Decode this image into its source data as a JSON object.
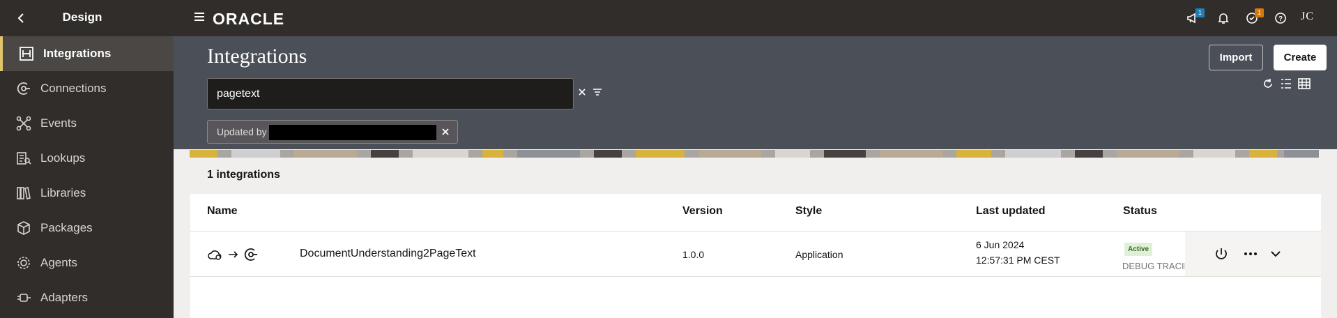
{
  "sidebar_header": {
    "title": "Design"
  },
  "topbar": {
    "brand": "ORACLE",
    "announcements_badge": "1",
    "tasks_badge": "1",
    "user_initials": "JC",
    "badge_colors": {
      "announcements": "#1f7fb5",
      "tasks": "#d97706"
    }
  },
  "sidebar": {
    "items": [
      {
        "label": "Integrations",
        "icon": "integrations-icon",
        "active": true
      },
      {
        "label": "Connections",
        "icon": "connections-icon"
      },
      {
        "label": "Events",
        "icon": "events-icon"
      },
      {
        "label": "Lookups",
        "icon": "lookups-icon"
      },
      {
        "label": "Libraries",
        "icon": "libraries-icon"
      },
      {
        "label": "Packages",
        "icon": "packages-icon"
      },
      {
        "label": "Agents",
        "icon": "agents-icon"
      },
      {
        "label": "Adapters",
        "icon": "adapters-icon"
      }
    ]
  },
  "header": {
    "title": "Integrations",
    "search_value": "pagetext",
    "filter_chip": {
      "label": "Updated by"
    },
    "import_label": "Import",
    "create_label": "Create"
  },
  "list": {
    "count_text": "1 integrations",
    "columns": {
      "name": "Name",
      "version": "Version",
      "style": "Style",
      "last_updated": "Last updated",
      "status": "Status"
    },
    "rows": [
      {
        "name": "DocumentUnderstanding2PageText",
        "version": "1.0.0",
        "style": "Application",
        "updated_date": "6 Jun 2024",
        "updated_time": "12:57:31 PM CEST",
        "status": "Active",
        "status_sub": "DEBUG TRACING"
      }
    ]
  }
}
